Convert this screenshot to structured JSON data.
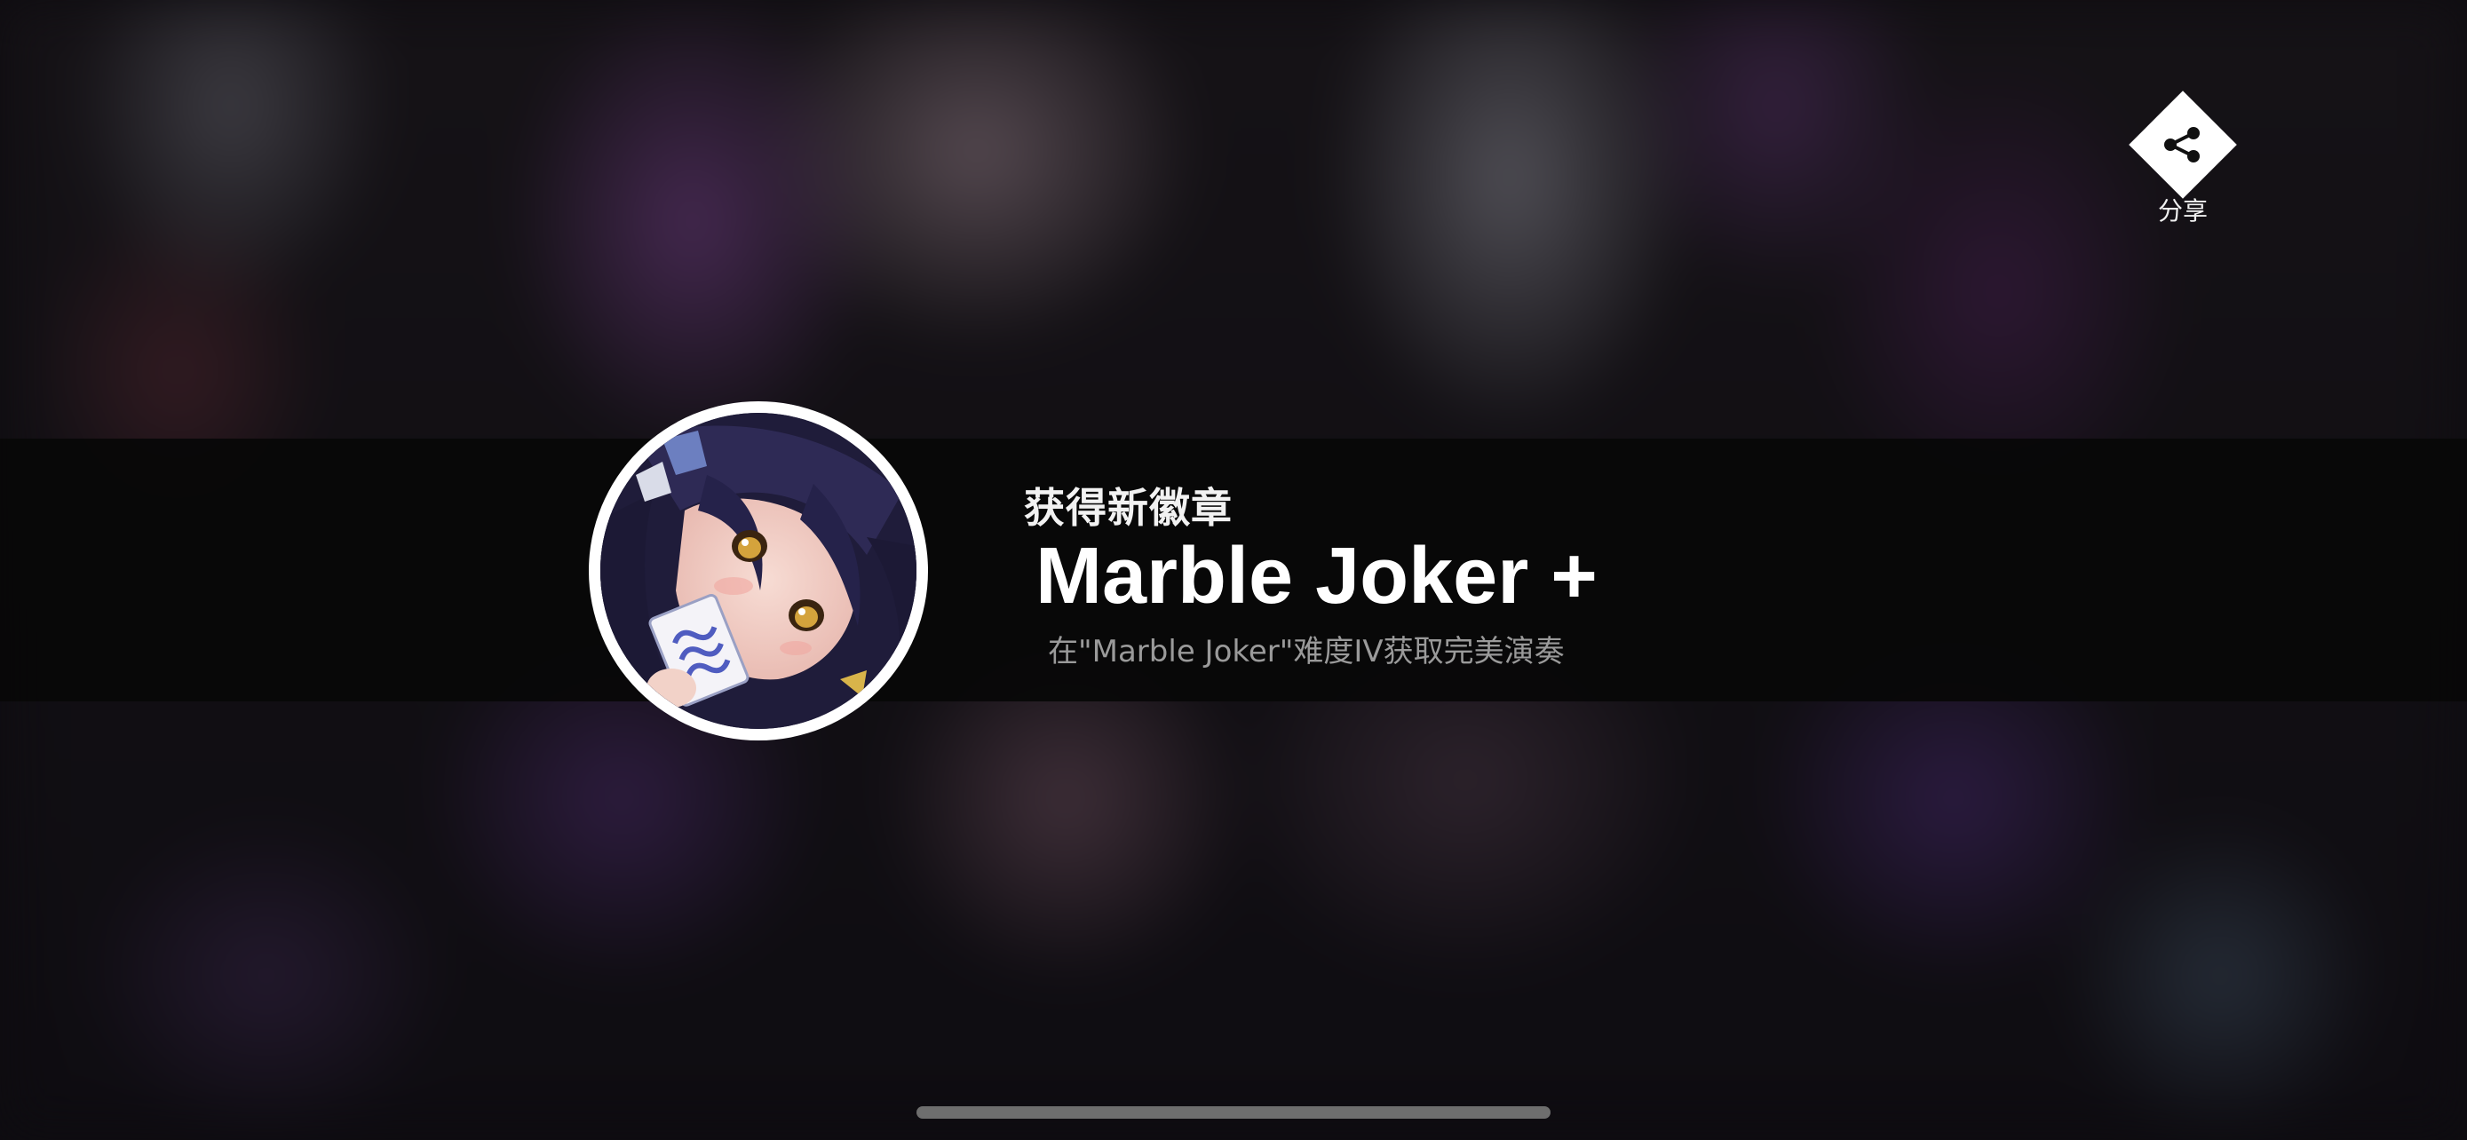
{
  "share": {
    "label": "分享",
    "icon": "share-icon"
  },
  "achievement": {
    "heading": "获得新徽章",
    "badge_name": "Marble Joker +",
    "description": "在\"Marble Joker\"难度IV获取完美演奏",
    "badge_image": "anime-girl-holding-card"
  },
  "colors": {
    "banner": "#080808",
    "badge_ring": "#ffffff",
    "title_text": "#ffffff",
    "description_text": "#9a9a9a"
  }
}
